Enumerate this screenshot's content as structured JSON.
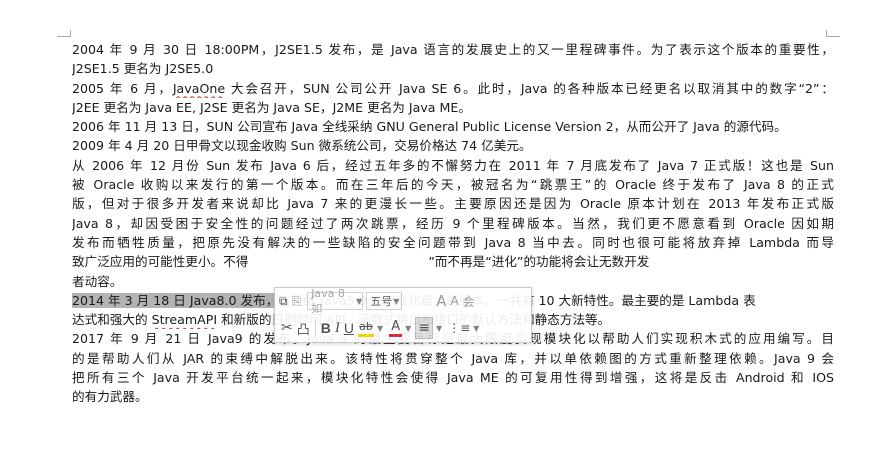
{
  "document": {
    "lines": [
      "2004 年 9 月 30 日 18:00PM，J2SE1.5 发布，是 Java 语言的发展史上的又一里程碑事件。为了表示这个版本的重要性，",
      "J2SE1.5 更名为 J2SE5.0",
      "2005 年 6 月，",
      "JavaOne",
      " 大会召开，SUN 公司公开 Java SE 6。此时，Java 的各种版本已经更名以取消其中的数字“2”：",
      "J2EE 更名为 Java EE, J2SE 更名为 Java SE，J2ME 更名为 Java ME。",
      "2006 年 11 月 13 日，SUN 公司宣布 Java 全线采纳 GNU General Public License Version 2，从而公开了 Java 的源代码。",
      "2009 年 4 月 20 日甲骨文以现金收购 Sun 微系统公司，交易价格达 74 亿美元。",
      "从 2006 年 12 月份 Sun 发布 Java 6 后，经过五年多的不懈努力在 2011 年 7 月底发布了 Java 7 正式版！这也是 Sun",
      "被 Oracle 收购以来发行的第一个版本。而在三年后的今天，被冠名为“跳票王”的 Oracle 终于发布了 Java 8 的正式",
      "版，但对于很多开发者来说却比 Java 7 来的更漫长一些。主要原因还是因为 Oracle 原本计划在 2013 年发布正式版",
      "Java 8，却因受困于安全性的问题经过了两次跳票，经历 9 个里程碑版本。当然，我们更不愿意看到 Oracle 因如期",
      "发布而牺牲质量，把原先没有解决的一些缺陷的安全问题带到 Java 8 当中去。同时也很可能将放弃掉 Lambda 而导",
      "致广泛应用的可能性更小。不得",
      "”而不再是“进化”的功能将会让无数开发",
      "者动容。",
      "2014 年 3 月 18 日 Java8.0 发布，",
      "这是继 Java5.0 以来变化最大的版本。一共有 10 大新特性。最主要的是 Lambda 表",
      "达式和强大的 ",
      "StreamAPI",
      " 和新版的日期时间 API，函数式接口和接口的默认方法和静态方法等。",
      "2017 年 9 月 21 日 Java9 的发布。Java 9 的最主要目标是最大限度实现模块化以帮助人们实现积木式的应用编写。目",
      "的是帮助人们从 JAR 的束缚中解脱出来。该特性将贯穿整个 Java 库，并以单依赖图的方式重新整理依赖。Java 9 会",
      "把所有三个 Java 开发平台统一起来，模块化特性会使得 Java ME 的可复用性得到增强，这将是反击 Android 和 IOS",
      "的有力武器。"
    ]
  },
  "mini_toolbar": {
    "font_name": "Java 8 如",
    "font_size": "五号",
    "row1_glyphs": [
      "⧉",
      "⎘",
      "A",
      "A",
      "会"
    ],
    "row2_glyphs": [
      "✂",
      "凸",
      "B",
      "I",
      "U",
      "ab",
      "A",
      "≡",
      "⋮≡"
    ]
  },
  "colors": {
    "selection": "#b3b3b3",
    "spell_underline": "#c0392b",
    "font_color_bar": "#d9262c",
    "highlight_bar": "#f5d800"
  }
}
